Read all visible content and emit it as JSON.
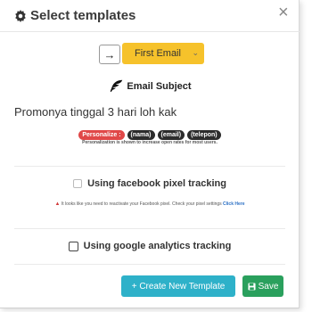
{
  "modal": {
    "title": "Select templates",
    "close_glyph": "×"
  },
  "template_select": {
    "arrow_glyph": "→",
    "selected": "First Email"
  },
  "subject": {
    "label": "Email Subject",
    "value": "Promonya tinggal 3 hari loh kak"
  },
  "personalize": {
    "chips": [
      "Personalize :",
      "(nama)",
      "(email)",
      "(telepon)"
    ],
    "hint": "Personalization is shown to increase open rates for most users."
  },
  "facebook": {
    "label": "Using facebook pixel tracking",
    "warning": "It looks like you need to reactivate your Facebook pixel. Check your pixel settings",
    "link": "Click Here"
  },
  "google": {
    "label": "Using google analytics tracking"
  },
  "buttons": {
    "create": "+ Create New Template",
    "save": "Save"
  },
  "colors": {
    "select_bg": "#f6c22b",
    "create_bg": "#2eb1c9",
    "save_bg": "#2aa05d",
    "personalize_chip": "#e04848"
  },
  "icons": [
    "gear-icon",
    "close-icon",
    "arrow-right-icon",
    "chevron-down-icon",
    "feather-icon",
    "warning-icon",
    "save-icon"
  ]
}
